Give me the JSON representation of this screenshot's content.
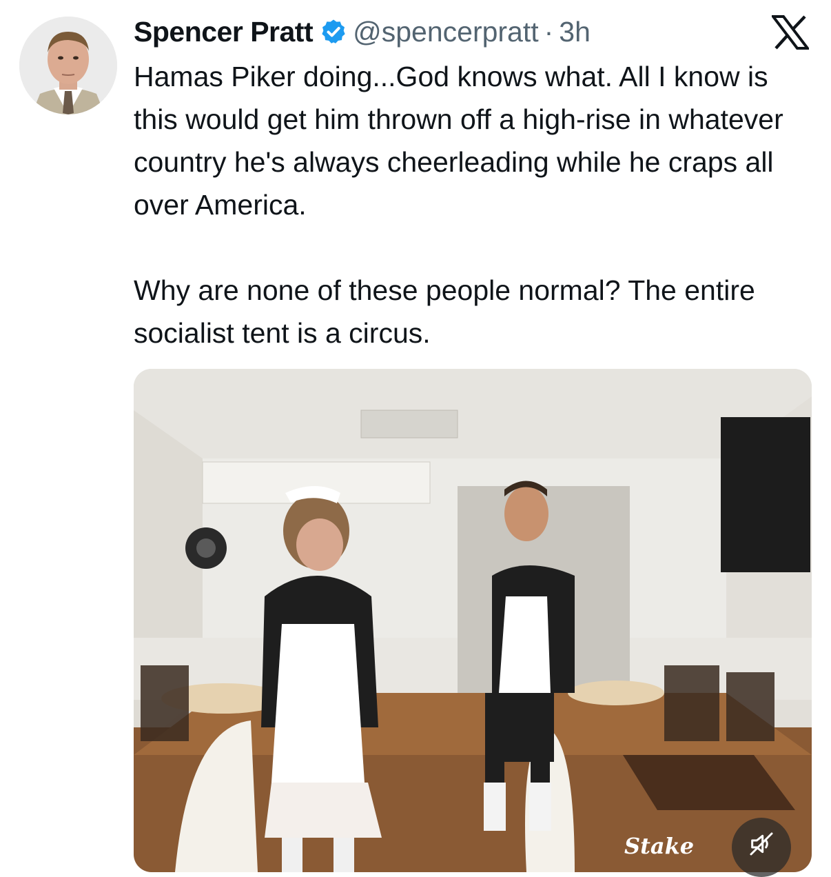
{
  "post": {
    "author_name": "Spencer Pratt",
    "handle": "@spencerpratt",
    "separator": "·",
    "time_ago": "3h",
    "verified_icon": "verified-badge-icon",
    "platform_icon": "x-logo-icon",
    "text_paragraphs": [
      "Hamas Piker doing...God knows what. All I know is this would get him thrown off a high-rise in whatever country he's always cheerleading while he craps all over America.",
      "Why are none of these people normal? The entire socialist tent is a circus."
    ]
  },
  "media": {
    "type": "video",
    "mute_icon": "speaker-muted-icon",
    "watermark_text": "Stake"
  },
  "colors": {
    "text": "#0f1419",
    "secondary_text": "#536471",
    "verified_blue": "#1d9bf0",
    "background": "#ffffff"
  }
}
